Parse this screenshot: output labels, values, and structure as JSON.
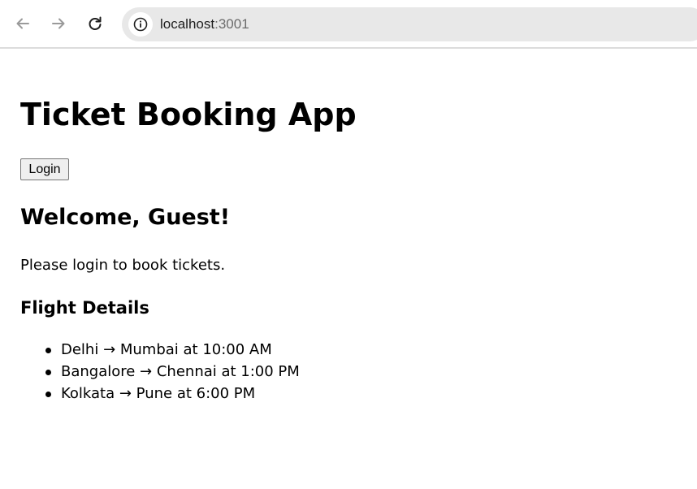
{
  "browser": {
    "url_host": "localhost",
    "url_port": ":3001",
    "icons": {
      "back": "arrow-left-icon",
      "forward": "arrow-right-icon",
      "reload": "reload-icon",
      "site_info": "info-icon"
    }
  },
  "app": {
    "title": "Ticket Booking App",
    "login_label": "Login",
    "welcome": "Welcome, Guest!",
    "prompt": "Please login to book tickets."
  },
  "flights": {
    "heading": "Flight Details",
    "items": [
      "Delhi → Mumbai at 10:00 AM",
      "Bangalore → Chennai at 1:00 PM",
      "Kolkata → Pune at 6:00 PM"
    ]
  }
}
